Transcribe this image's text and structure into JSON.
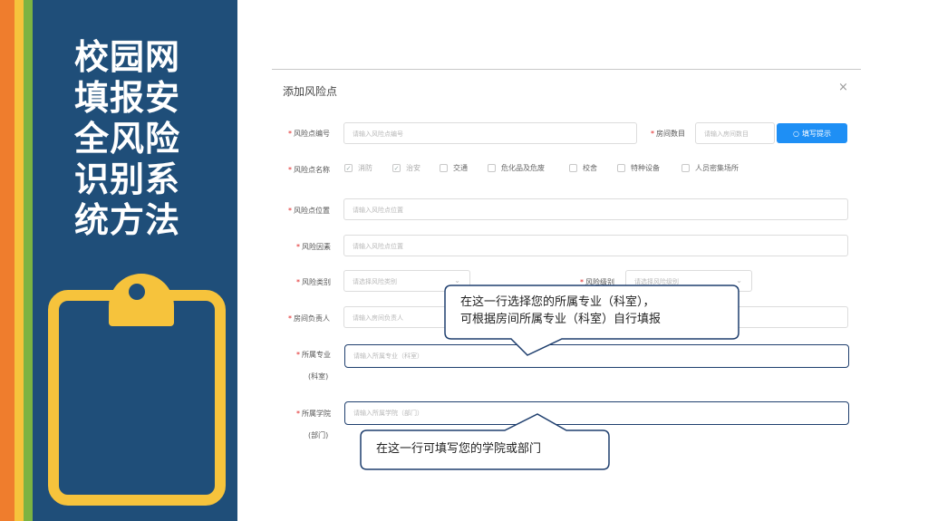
{
  "slide": {
    "title_lines": [
      "校园网",
      "填报安",
      "全风险",
      "识别系",
      "统方法"
    ]
  },
  "dialog": {
    "title": "添加风险点",
    "close": "×",
    "tip_button": "填写提示",
    "fields": {
      "risk_no": {
        "label": "风险点编号",
        "placeholder": "请输入风险点编号"
      },
      "room_count": {
        "label": "房间数目",
        "placeholder": "请输入房间数目"
      },
      "risk_name": {
        "label": "风险点名称"
      },
      "risk_location": {
        "label": "风险点位置",
        "placeholder": "请输入风险点位置"
      },
      "risk_factor": {
        "label": "风险因素",
        "placeholder": "请输入风险点位置"
      },
      "risk_type": {
        "label": "风险类别",
        "placeholder": "请选择风险类别"
      },
      "risk_level": {
        "label": "风险级别",
        "placeholder": "请选择风险级别"
      },
      "room_owner": {
        "label": "房间负责人",
        "placeholder": "请输入房间负责人"
      },
      "major": {
        "label": "所属专业",
        "label2": "(科室)",
        "placeholder": "请输入所属专业（科室）"
      },
      "college": {
        "label": "所属学院",
        "label2": "(部门)",
        "placeholder": "请输入所属学院（部门）"
      }
    },
    "risk_name_options": [
      {
        "label": "消防",
        "checked": true
      },
      {
        "label": "治安",
        "checked": true
      },
      {
        "label": "交通",
        "checked": false
      },
      {
        "label": "危化品及危废",
        "checked": false
      },
      {
        "label": "校舍",
        "checked": false
      },
      {
        "label": "特种设备",
        "checked": false
      },
      {
        "label": "人员密集场所",
        "checked": false
      }
    ]
  },
  "callouts": {
    "major_line1": "在这一行选择您的所属专业（科室），",
    "major_line2": "可根据房间所属专业（科室）自行填报",
    "college": "在这一行可填写您的学院或部门"
  },
  "colors": {
    "panel": "#1f4e79",
    "accent_yellow": "#f6c33c",
    "accent_orange": "#ef7d2d",
    "accent_green": "#7cb342",
    "button_blue": "#1e8ff5"
  }
}
